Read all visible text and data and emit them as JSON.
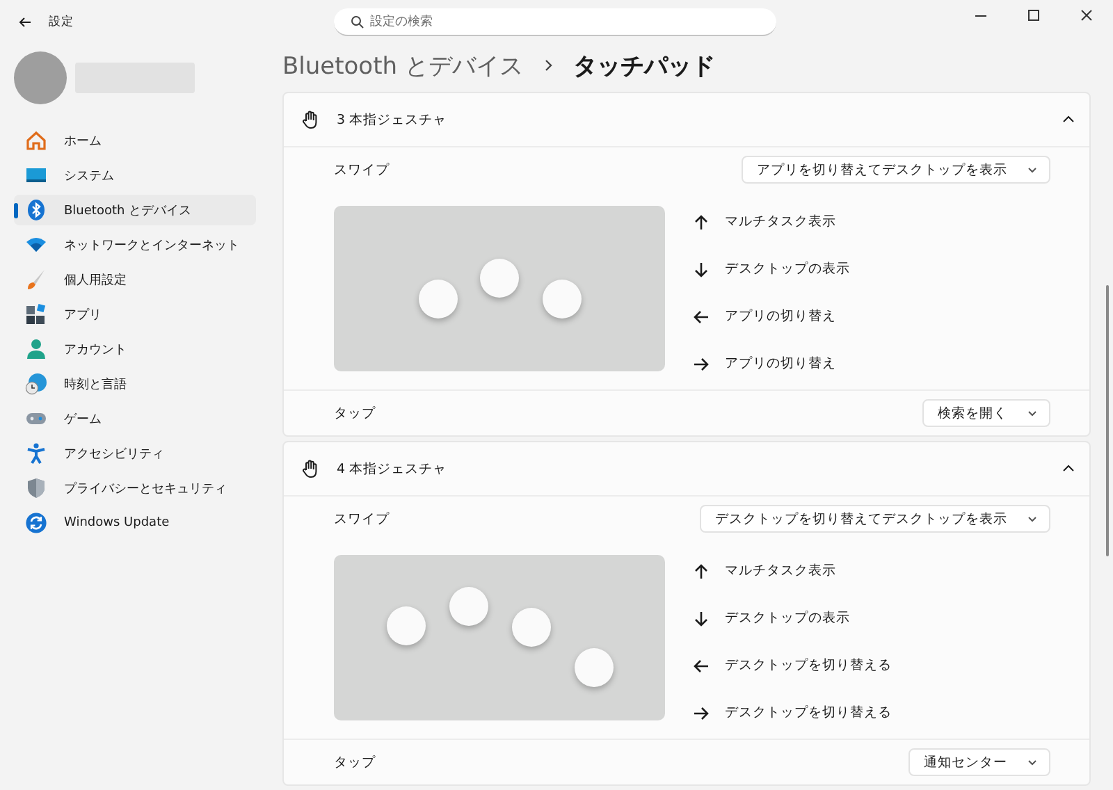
{
  "window": {
    "title": "設定"
  },
  "search": {
    "placeholder": "設定の検索"
  },
  "sidebar": {
    "items": [
      {
        "label": "ホーム",
        "kind": "home",
        "selected": false
      },
      {
        "label": "システム",
        "kind": "system",
        "selected": false
      },
      {
        "label": "Bluetooth とデバイス",
        "kind": "bluetooth",
        "selected": true
      },
      {
        "label": "ネットワークとインターネット",
        "kind": "network",
        "selected": false
      },
      {
        "label": "個人用設定",
        "kind": "brush",
        "selected": false
      },
      {
        "label": "アプリ",
        "kind": "apps",
        "selected": false
      },
      {
        "label": "アカウント",
        "kind": "account",
        "selected": false
      },
      {
        "label": "時刻と言語",
        "kind": "time",
        "selected": false
      },
      {
        "label": "ゲーム",
        "kind": "game",
        "selected": false
      },
      {
        "label": "アクセシビリティ",
        "kind": "accessibility",
        "selected": false
      },
      {
        "label": "プライバシーとセキュリティ",
        "kind": "shield",
        "selected": false
      },
      {
        "label": "Windows Update",
        "kind": "update",
        "selected": false
      }
    ]
  },
  "breadcrumb": {
    "parent": "Bluetooth とデバイス",
    "current": "タッチパッド"
  },
  "sections": [
    {
      "title": "3 本指ジェスチャ",
      "kind": "three_finger",
      "expanded": true,
      "swipe_label": "スワイプ",
      "swipe_value": "アプリを切り替えてデスクトップを表示",
      "gestures": [
        {
          "kind": "up",
          "label": "マルチタスク表示"
        },
        {
          "kind": "down",
          "label": "デスクトップの表示"
        },
        {
          "kind": "left",
          "label": "アプリの切り替え"
        },
        {
          "kind": "right",
          "label": "アプリの切り替え"
        }
      ],
      "tap_label": "タップ",
      "tap_value": "検索を開く"
    },
    {
      "title": "4 本指ジェスチャ",
      "kind": "four_finger",
      "expanded": true,
      "swipe_label": "スワイプ",
      "swipe_value": "デスクトップを切り替えてデスクトップを表示",
      "gestures": [
        {
          "kind": "up",
          "label": "マルチタスク表示"
        },
        {
          "kind": "down",
          "label": "デスクトップの表示"
        },
        {
          "kind": "left",
          "label": "デスクトップを切り替える"
        },
        {
          "kind": "right",
          "label": "デスクトップを切り替える"
        }
      ],
      "tap_label": "タップ",
      "tap_value": "通知センター"
    }
  ]
}
